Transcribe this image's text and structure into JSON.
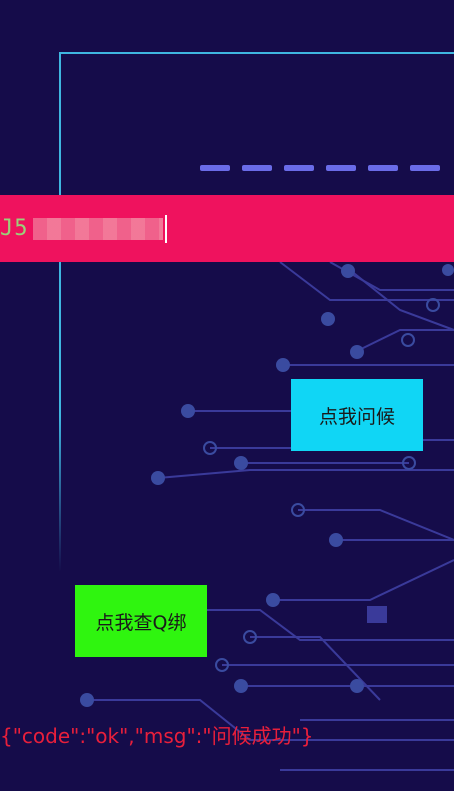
{
  "input": {
    "value_prefix": "J5"
  },
  "buttons": {
    "greet": "点我问候",
    "check_q": "点我查Q绑"
  },
  "result": {
    "text": "{\"code\":\"ok\",\"msg\":\"问候成功\"}"
  },
  "colors": {
    "background": "#150c4a",
    "frame": "#3fb6e0",
    "input_bar": "#ef125e",
    "greet_button": "#10d6f5",
    "check_button": "#2ff50f",
    "result_text": "#e81f3b"
  }
}
